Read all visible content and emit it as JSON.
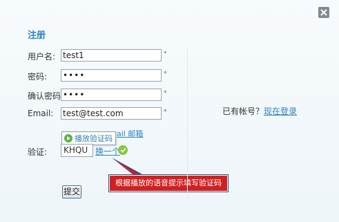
{
  "dialog": {
    "title": "注册"
  },
  "form": {
    "username_label": "用户名:",
    "username_value": "test1",
    "password_label": "密码:",
    "password_value": "••••",
    "confirm_label": "确认密码:",
    "confirm_value": "••••",
    "email_label": "Email:",
    "email_value": "test@test.com",
    "required_mark": "*",
    "email_hint_link": "ail 邮箱",
    "play_captcha_label": "播放验证码",
    "captcha_label": "验证:",
    "captcha_value": "KHQU",
    "refresh_link": "换一个",
    "submit_label": "提交"
  },
  "side": {
    "have_account": "已有帐号？",
    "login_link": "现在登录"
  },
  "callout": {
    "text": "根据播放的语音提示填写验证码"
  },
  "icons": {
    "close": "close-icon",
    "play": "play-icon",
    "check": "check-icon"
  },
  "colors": {
    "accent": "#2f83bd",
    "callout_bg": "#d12020",
    "success": "#8cc63e"
  }
}
